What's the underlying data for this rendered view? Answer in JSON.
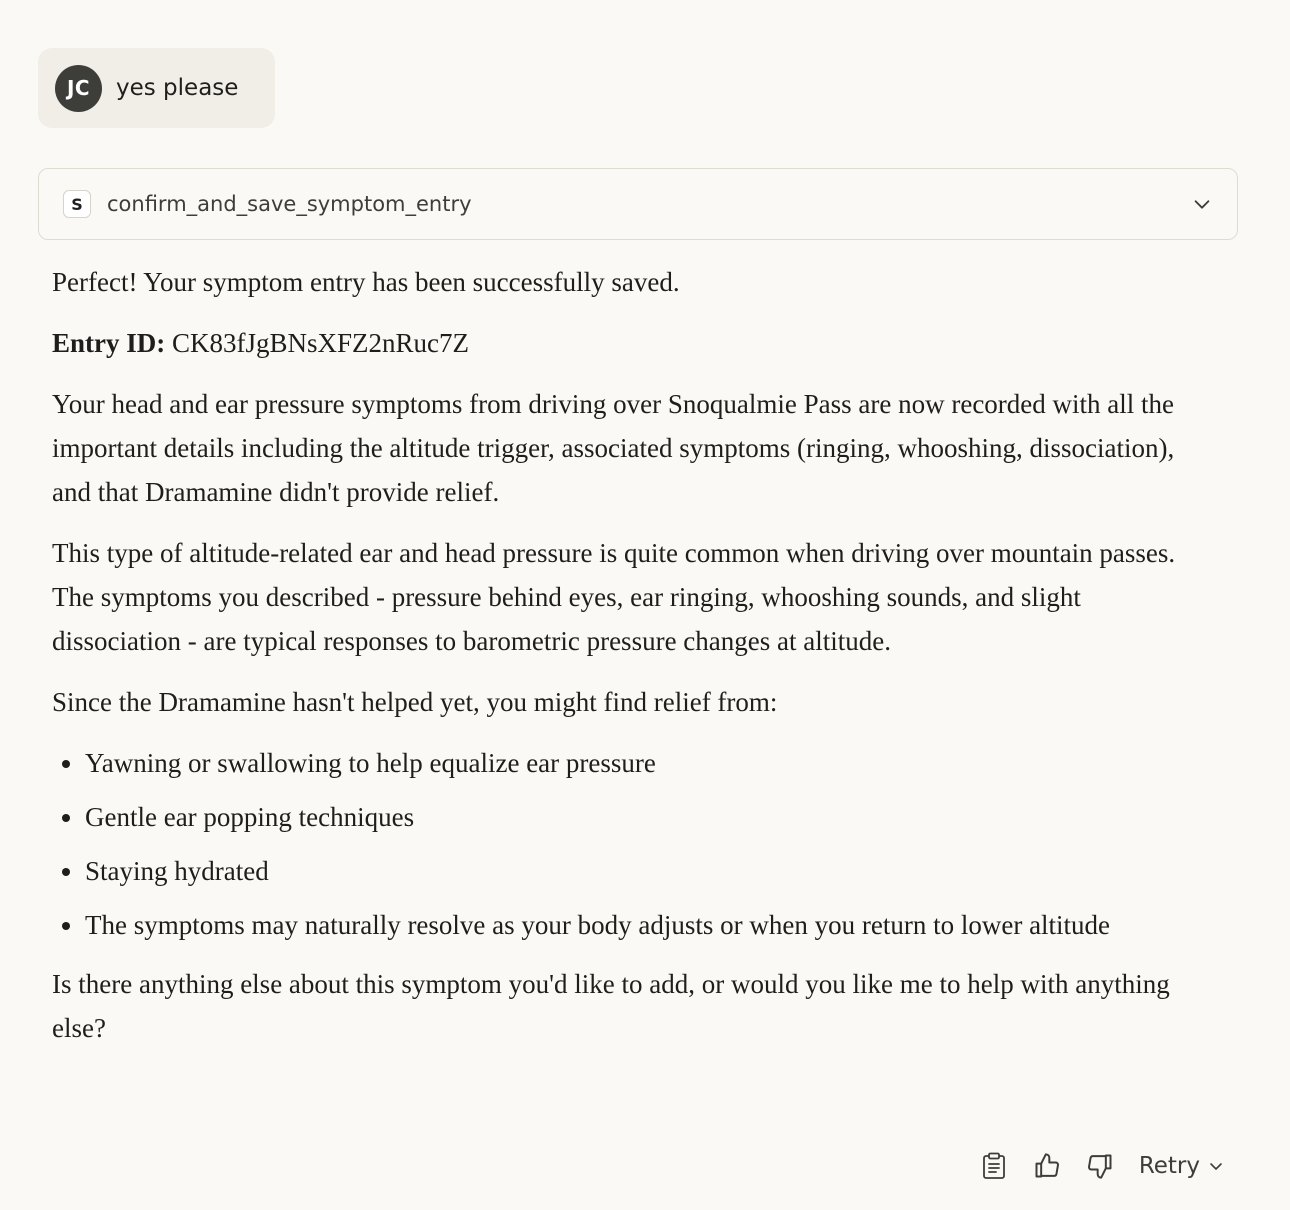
{
  "user_message": {
    "avatar_initials": "JC",
    "text": "yes please"
  },
  "tool_call": {
    "badge": "S",
    "name": "confirm_and_save_symptom_entry",
    "expand_icon": "chevron-down-icon"
  },
  "response": {
    "intro": "Perfect! Your symptom entry has been successfully saved.",
    "entry_id_label": "Entry ID:",
    "entry_id_value": "CK83fJgBNsXFZ2nRuc7Z",
    "para1": "Your head and ear pressure symptoms from driving over Snoqualmie Pass are now recorded with all the important details including the altitude trigger, associated symptoms (ringing, whooshing, dissociation), and that Dramamine didn't provide relief.",
    "para2": "This type of altitude-related ear and head pressure is quite common when driving over mountain passes. The symptoms you described - pressure behind eyes, ear ringing, whooshing sounds, and slight dissociation - are typical responses to barometric pressure changes at altitude.",
    "para3": "Since the Dramamine hasn't helped yet, you might find relief from:",
    "tips": [
      "Yawning or swallowing to help equalize ear pressure",
      "Gentle ear popping techniques",
      "Staying hydrated",
      "The symptoms may naturally resolve as your body adjusts or when you return to lower altitude"
    ],
    "closing": "Is there anything else about this symptom you'd like to add, or would you like me to help with anything else?"
  },
  "actions": {
    "copy_icon": "clipboard-icon",
    "thumbs_up_icon": "thumbs-up-icon",
    "thumbs_down_icon": "thumbs-down-icon",
    "retry_label": "Retry"
  }
}
